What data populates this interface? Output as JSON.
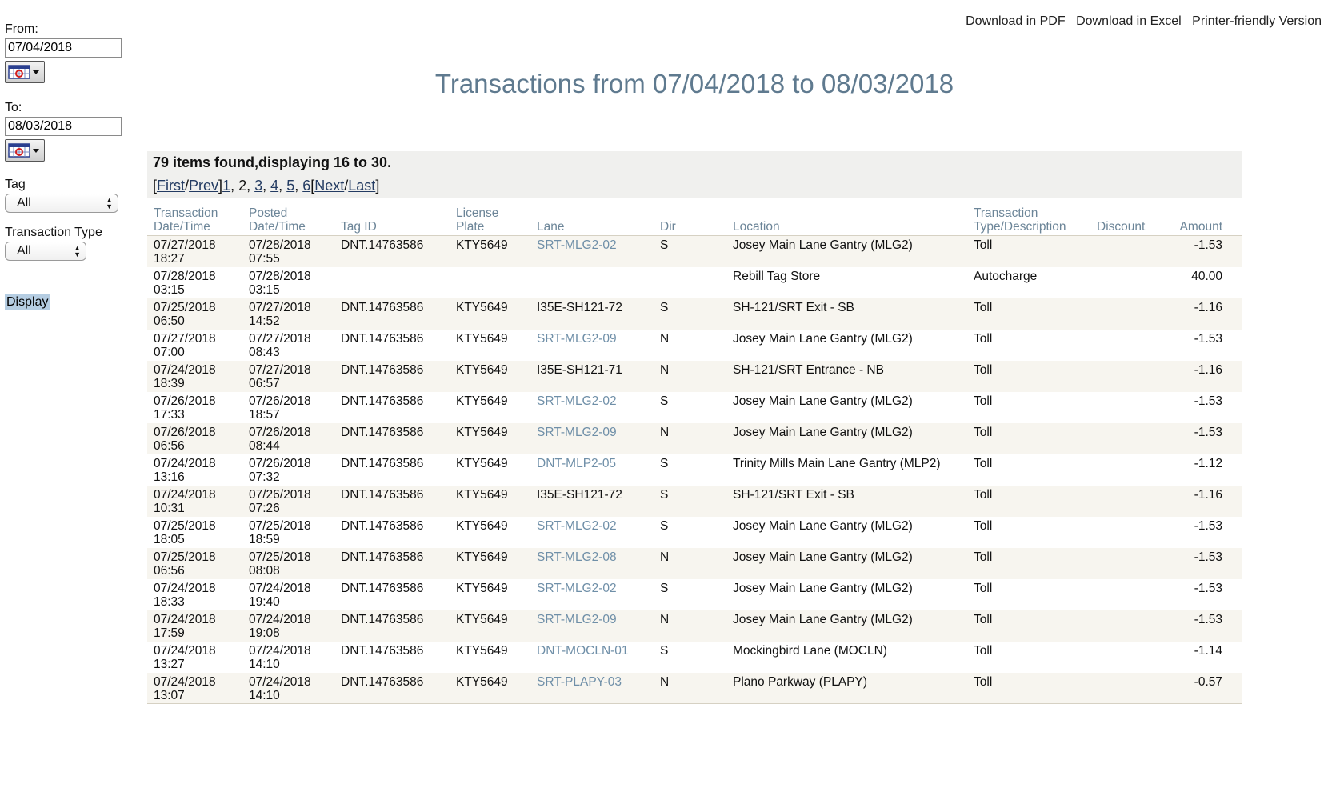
{
  "filters": {
    "from_label": "From:",
    "from_value": "07/04/2018",
    "to_label": "To:",
    "to_value": "08/03/2018",
    "tag_label": "Tag",
    "tag_value": "All",
    "type_label": "Transaction Type",
    "type_value": "All",
    "display_label": "Display"
  },
  "top_links": {
    "pdf": "Download in PDF",
    "excel": "Download in Excel",
    "printer": "Printer-friendly Version"
  },
  "title": "Transactions from 07/04/2018 to 08/03/2018",
  "results": {
    "count_text": "79 items found,displaying 16 to 30.",
    "pager": {
      "open": "[",
      "first": "First",
      "slash1": "/",
      "prev": "Prev",
      "close1": "]",
      "p1": "1",
      "sep1": ", ",
      "p2": "2",
      "sep2": ", ",
      "p3": "3",
      "sep3": ", ",
      "p4": "4",
      "sep4": ", ",
      "p5": "5",
      "sep5": ", ",
      "p6": "6",
      "open2": "[",
      "next": "Next",
      "slash2": "/",
      "last": "Last",
      "close2": "]"
    }
  },
  "table": {
    "headers": {
      "txn_date_1": "Transaction",
      "txn_date_2": "Date/Time",
      "posted_1": "Posted",
      "posted_2": "Date/Time",
      "tag_id": "Tag ID",
      "plate_1": "License",
      "plate_2": "Plate",
      "lane": "Lane",
      "dir": "Dir",
      "location": "Location",
      "type_1": "Transaction",
      "type_2": "Type/Description",
      "discount": "Discount",
      "amount": "Amount"
    },
    "rows": [
      {
        "txn_date": "07/27/2018",
        "txn_time": "18:27",
        "post_date": "07/28/2018",
        "post_time": "07:55",
        "tag": "DNT.14763586",
        "plate": "KTY5649",
        "lane": "SRT-MLG2-02",
        "lane_link": true,
        "dir": "S",
        "location": "Josey Main Lane Gantry (MLG2)",
        "type": "Toll",
        "discount": "",
        "amount": "-1.53"
      },
      {
        "txn_date": "07/28/2018",
        "txn_time": "03:15",
        "post_date": "07/28/2018",
        "post_time": "03:15",
        "tag": "",
        "plate": "",
        "lane": "",
        "lane_link": false,
        "dir": "",
        "location": "Rebill Tag Store",
        "type": "Autocharge",
        "discount": "",
        "amount": "40.00"
      },
      {
        "txn_date": "07/25/2018",
        "txn_time": "06:50",
        "post_date": "07/27/2018",
        "post_time": "14:52",
        "tag": "DNT.14763586",
        "plate": "KTY5649",
        "lane": "I35E-SH121-72",
        "lane_link": false,
        "dir": "S",
        "location": "SH-121/SRT Exit - SB",
        "type": "Toll",
        "discount": "",
        "amount": "-1.16"
      },
      {
        "txn_date": "07/27/2018",
        "txn_time": "07:00",
        "post_date": "07/27/2018",
        "post_time": "08:43",
        "tag": "DNT.14763586",
        "plate": "KTY5649",
        "lane": "SRT-MLG2-09",
        "lane_link": true,
        "dir": "N",
        "location": "Josey Main Lane Gantry (MLG2)",
        "type": "Toll",
        "discount": "",
        "amount": "-1.53"
      },
      {
        "txn_date": "07/24/2018",
        "txn_time": "18:39",
        "post_date": "07/27/2018",
        "post_time": "06:57",
        "tag": "DNT.14763586",
        "plate": "KTY5649",
        "lane": "I35E-SH121-71",
        "lane_link": false,
        "dir": "N",
        "location": "SH-121/SRT Entrance - NB",
        "type": "Toll",
        "discount": "",
        "amount": "-1.16"
      },
      {
        "txn_date": "07/26/2018",
        "txn_time": "17:33",
        "post_date": "07/26/2018",
        "post_time": "18:57",
        "tag": "DNT.14763586",
        "plate": "KTY5649",
        "lane": "SRT-MLG2-02",
        "lane_link": true,
        "dir": "S",
        "location": "Josey Main Lane Gantry (MLG2)",
        "type": "Toll",
        "discount": "",
        "amount": "-1.53"
      },
      {
        "txn_date": "07/26/2018",
        "txn_time": "06:56",
        "post_date": "07/26/2018",
        "post_time": "08:44",
        "tag": "DNT.14763586",
        "plate": "KTY5649",
        "lane": "SRT-MLG2-09",
        "lane_link": true,
        "dir": "N",
        "location": "Josey Main Lane Gantry (MLG2)",
        "type": "Toll",
        "discount": "",
        "amount": "-1.53"
      },
      {
        "txn_date": "07/24/2018",
        "txn_time": "13:16",
        "post_date": "07/26/2018",
        "post_time": "07:32",
        "tag": "DNT.14763586",
        "plate": "KTY5649",
        "lane": "DNT-MLP2-05",
        "lane_link": true,
        "dir": "S",
        "location": "Trinity Mills Main Lane Gantry (MLP2)",
        "type": "Toll",
        "discount": "",
        "amount": "-1.12"
      },
      {
        "txn_date": "07/24/2018",
        "txn_time": "10:31",
        "post_date": "07/26/2018",
        "post_time": "07:26",
        "tag": "DNT.14763586",
        "plate": "KTY5649",
        "lane": "I35E-SH121-72",
        "lane_link": false,
        "dir": "S",
        "location": "SH-121/SRT Exit - SB",
        "type": "Toll",
        "discount": "",
        "amount": "-1.16"
      },
      {
        "txn_date": "07/25/2018",
        "txn_time": "18:05",
        "post_date": "07/25/2018",
        "post_time": "18:59",
        "tag": "DNT.14763586",
        "plate": "KTY5649",
        "lane": "SRT-MLG2-02",
        "lane_link": true,
        "dir": "S",
        "location": "Josey Main Lane Gantry (MLG2)",
        "type": "Toll",
        "discount": "",
        "amount": "-1.53"
      },
      {
        "txn_date": "07/25/2018",
        "txn_time": "06:56",
        "post_date": "07/25/2018",
        "post_time": "08:08",
        "tag": "DNT.14763586",
        "plate": "KTY5649",
        "lane": "SRT-MLG2-08",
        "lane_link": true,
        "dir": "N",
        "location": "Josey Main Lane Gantry (MLG2)",
        "type": "Toll",
        "discount": "",
        "amount": "-1.53"
      },
      {
        "txn_date": "07/24/2018",
        "txn_time": "18:33",
        "post_date": "07/24/2018",
        "post_time": "19:40",
        "tag": "DNT.14763586",
        "plate": "KTY5649",
        "lane": "SRT-MLG2-02",
        "lane_link": true,
        "dir": "S",
        "location": "Josey Main Lane Gantry (MLG2)",
        "type": "Toll",
        "discount": "",
        "amount": "-1.53"
      },
      {
        "txn_date": "07/24/2018",
        "txn_time": "17:59",
        "post_date": "07/24/2018",
        "post_time": "19:08",
        "tag": "DNT.14763586",
        "plate": "KTY5649",
        "lane": "SRT-MLG2-09",
        "lane_link": true,
        "dir": "N",
        "location": "Josey Main Lane Gantry (MLG2)",
        "type": "Toll",
        "discount": "",
        "amount": "-1.53"
      },
      {
        "txn_date": "07/24/2018",
        "txn_time": "13:27",
        "post_date": "07/24/2018",
        "post_time": "14:10",
        "tag": "DNT.14763586",
        "plate": "KTY5649",
        "lane": "DNT-MOCLN-01",
        "lane_link": true,
        "dir": "S",
        "location": "Mockingbird Lane (MOCLN)",
        "type": "Toll",
        "discount": "",
        "amount": "-1.14"
      },
      {
        "txn_date": "07/24/2018",
        "txn_time": "13:07",
        "post_date": "07/24/2018",
        "post_time": "14:10",
        "tag": "DNT.14763586",
        "plate": "KTY5649",
        "lane": "SRT-PLAPY-03",
        "lane_link": true,
        "dir": "N",
        "location": "Plano Parkway (PLAPY)",
        "type": "Toll",
        "discount": "",
        "amount": "-0.57"
      }
    ]
  },
  "icons": {
    "calendar": "calendar-icon",
    "dropdown": "chevron-down-icon",
    "select_arrows": "select-arrows-icon"
  },
  "colors": {
    "title": "#5f7a8f",
    "header_text": "#6c8598",
    "lane_link": "#6f8fa8",
    "row_alt": "#f7f5ef",
    "panel_bg": "#f0f0ee",
    "display_button": "#b5cde2"
  }
}
